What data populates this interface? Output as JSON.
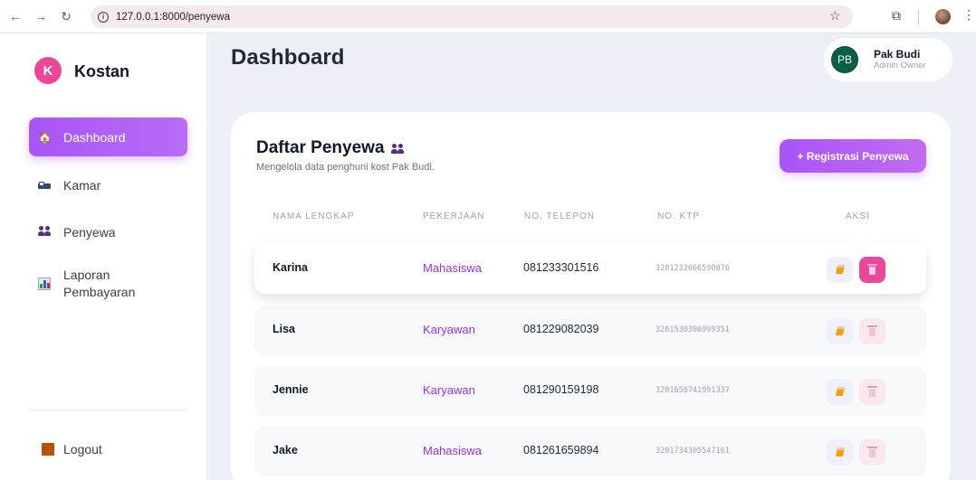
{
  "browser": {
    "url": "127.0.0.1:8000/penyewa"
  },
  "sidebar": {
    "logo_letter": "K",
    "app_name": "Kostan",
    "items": [
      {
        "label": "Dashboard",
        "icon": "house-icon",
        "active": true
      },
      {
        "label": "Kamar",
        "icon": "bed-icon",
        "active": false
      },
      {
        "label": "Penyewa",
        "icon": "people-icon",
        "active": false
      },
      {
        "label": "Laporan Pembayaran",
        "icon": "chart-icon",
        "active": false
      }
    ],
    "logout_label": "Logout"
  },
  "header": {
    "title": "Dashboard",
    "user": {
      "initials": "PB",
      "name": "Pak Budi",
      "role": "Admin Owner"
    }
  },
  "card": {
    "title": "Daftar Penyewa",
    "subtitle": "Mengelola data penghuni kost Pak Budi.",
    "add_button": "+ Registrasi Penyewa",
    "columns": [
      "NAMA LENGKAP",
      "PEKERJAAN",
      "NO. TELEPON",
      "NO. KTP",
      "AKSI"
    ],
    "rows": [
      {
        "name": "Karina",
        "job": "Mahasiswa",
        "phone": "081233301516",
        "ktp": "3201232666590876"
      },
      {
        "name": "Lisa",
        "job": "Karyawan",
        "phone": "081229082039",
        "ktp": "3201530306999351"
      },
      {
        "name": "Jennie",
        "job": "Karyawan",
        "phone": "081290159198",
        "ktp": "3201650741991337"
      },
      {
        "name": "Jake",
        "job": "Mahasiswa",
        "phone": "081261659894",
        "ktp": "3201734305547161"
      }
    ]
  },
  "colors": {
    "accent": "#a855f7",
    "delete": "#ec4899",
    "avatar": "#065f46"
  }
}
